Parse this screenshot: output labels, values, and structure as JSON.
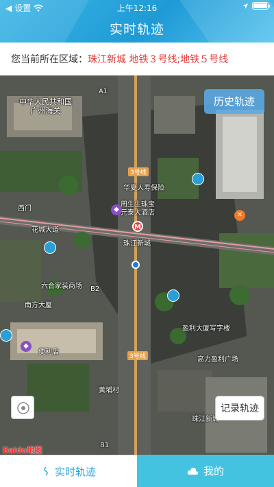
{
  "status_bar": {
    "carrier": "设置",
    "time": "上午12:16",
    "battery_percent": 100
  },
  "header": {
    "title": "实时轨迹"
  },
  "region": {
    "label": "您当前所在区域：",
    "value": "珠江新城 地铁３号线;地铁５号线"
  },
  "map": {
    "buttons": {
      "history": "历史轨迹",
      "record": "记录轨迹"
    },
    "logo_text": "Baidu地图",
    "labels": {
      "customs": "中华人民共和国\n广州海关",
      "station": "珠江新城",
      "line3_top": "3号线",
      "line3_bottom": "3号线",
      "bank": "华夏人寿保险",
      "bank2": "周生生珠宝\n元泰大酒店",
      "west_gate": "西门",
      "liuhe": "六合家装商场",
      "nanfang": "南方大厦",
      "huacheng": "花城大道",
      "yingli": "盈利大厦写字楼",
      "gaoli": "高力盈利广场",
      "ribao": "珠江新城",
      "store": "便利店",
      "zhujiang_bottom": "珠江新城",
      "huangpu": "黄埔村",
      "b1": "B1",
      "b2": "B2",
      "a1": "A1"
    },
    "icon_colors": {
      "bus": "#2a9fd6",
      "metro": "#e04040",
      "shop": "#8a4fc2",
      "food": "#f07a2a",
      "location": "#1f7be0"
    }
  },
  "tabs": {
    "live": "实时轨迹",
    "mine": "我的"
  }
}
